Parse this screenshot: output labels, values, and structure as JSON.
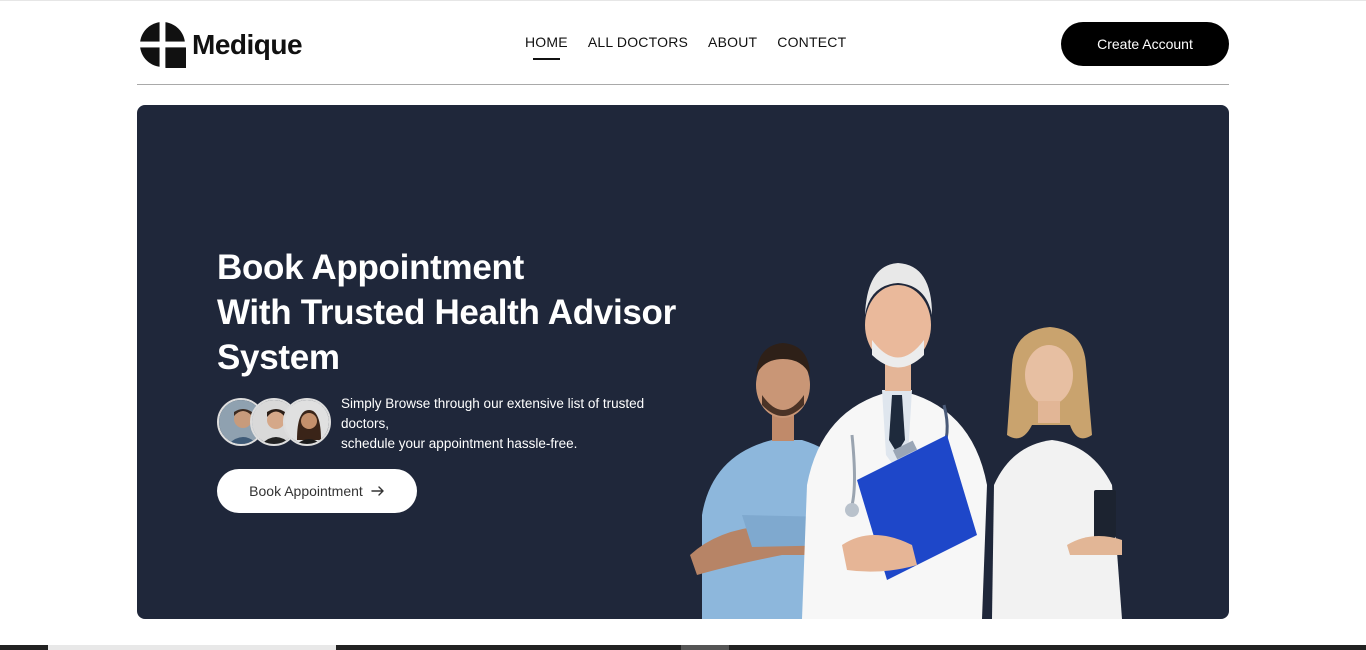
{
  "brand": {
    "name": "Medique",
    "icon": "medical-cross-logo-icon"
  },
  "nav": {
    "items": [
      {
        "label": "HOME",
        "active": true
      },
      {
        "label": "ALL DOCTORS",
        "active": false
      },
      {
        "label": "ABOUT",
        "active": false
      },
      {
        "label": "CONTECT",
        "active": false
      }
    ],
    "cta_label": "Create Account"
  },
  "hero": {
    "headline_line1": "Book Appointment",
    "headline_line2": "With Trusted Health Advisor",
    "headline_line3": "System",
    "description_line1": "Simply Browse through our extensive list of trusted doctors,",
    "description_line2": "schedule your appointment hassle-free.",
    "button_label": "Book Appointment",
    "button_icon": "arrow-right-icon",
    "background_color": "#1f273a"
  }
}
